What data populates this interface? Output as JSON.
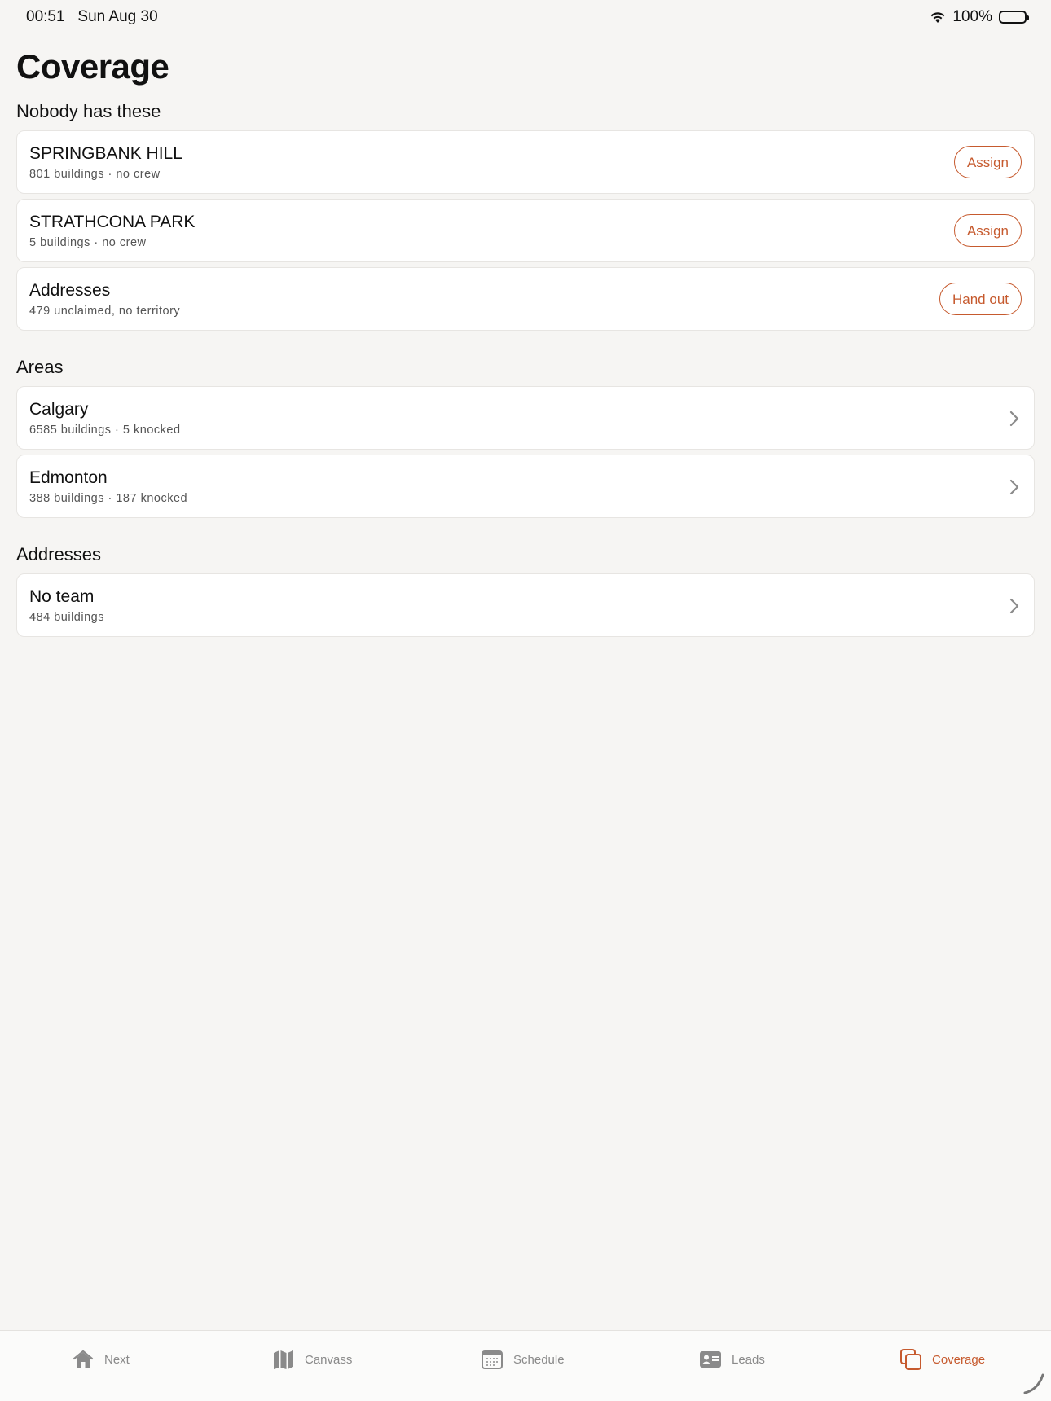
{
  "status": {
    "time": "00:51",
    "date": "Sun Aug 30",
    "battery": "100%"
  },
  "page": {
    "title": "Coverage"
  },
  "sections": {
    "unassigned": {
      "title": "Nobody has these",
      "items": [
        {
          "title": "SPRINGBANK HILL",
          "sub": "801 buildings · no crew",
          "action": "Assign"
        },
        {
          "title": "STRATHCONA PARK",
          "sub": "5 buildings · no crew",
          "action": "Assign"
        },
        {
          "title": "Addresses",
          "sub": "479 unclaimed, no territory",
          "action": "Hand out"
        }
      ]
    },
    "areas": {
      "title": "Areas",
      "items": [
        {
          "title": "Calgary",
          "sub": "6585 buildings · 5 knocked"
        },
        {
          "title": "Edmonton",
          "sub": "388 buildings · 187 knocked"
        }
      ]
    },
    "addresses": {
      "title": "Addresses",
      "items": [
        {
          "title": "No team",
          "sub": "484 buildings"
        }
      ]
    }
  },
  "tabbar": {
    "tabs": [
      {
        "label": "Next",
        "icon": "house-icon"
      },
      {
        "label": "Canvass",
        "icon": "map-icon"
      },
      {
        "label": "Schedule",
        "icon": "calendar-icon"
      },
      {
        "label": "Leads",
        "icon": "contact-card-icon"
      },
      {
        "label": "Coverage",
        "icon": "stacked-squares-icon",
        "active": true
      }
    ]
  },
  "colors": {
    "accent": "#c65a2e",
    "background": "#f6f5f3",
    "card": "#ffffff",
    "muted": "#8a8a8a"
  }
}
